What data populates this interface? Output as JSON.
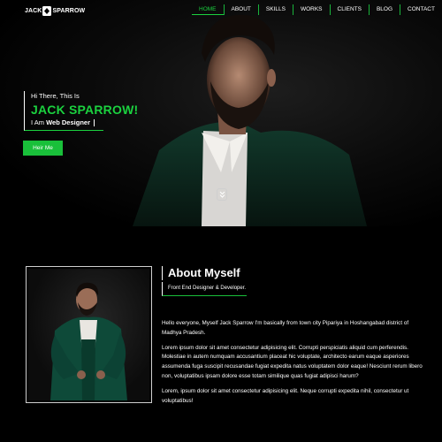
{
  "brand": {
    "logo_left": "JACK",
    "logo_right": "SPARROW"
  },
  "nav": {
    "items": [
      {
        "label": "HOME",
        "active": true
      },
      {
        "label": "ABOUT"
      },
      {
        "label": "SKILLS"
      },
      {
        "label": "WORKS"
      },
      {
        "label": "CLIENTS"
      },
      {
        "label": "BLOG"
      },
      {
        "label": "CONTACT"
      }
    ]
  },
  "hero": {
    "greeting": "Hi There, This Is",
    "name": "JACK SPARROW!",
    "role_prefix": "I Am",
    "role": "Web Designer",
    "cta": "Heir Me"
  },
  "about": {
    "title": "About Myself",
    "subtitle": "Front End Designer & Developer.",
    "paragraphs": [
      "Hello everyone, Myself Jack Sparrow I'm basically from town city Pipariya in Hoshangabad district of Madhya Pradesh.",
      "Lorem ipsum dolor sit amet consectetur adipisicing elit. Corrupti perspiciatis aliquid cum perferendis. Molestiae in autem numquam accusantium placeat hic voluptate, architecto earum eaque asperiores assumenda fuga suscipit recusandae fugiat expedita natus voluptatem dolor eaque! Nesciunt rerum libero non, voluptatibus ipsam dolore esse totam similique quas fugiat adipisci harum?",
      "Lorem, ipsum dolor sit amet consectetur adipisicing elit. Neque corrupti expedita nihil, consectetur ut voluptatibus!"
    ]
  },
  "colors": {
    "accent": "#1bd13f",
    "background": "#000000"
  },
  "icons": {
    "scroll": "chevron-double-down-icon"
  }
}
